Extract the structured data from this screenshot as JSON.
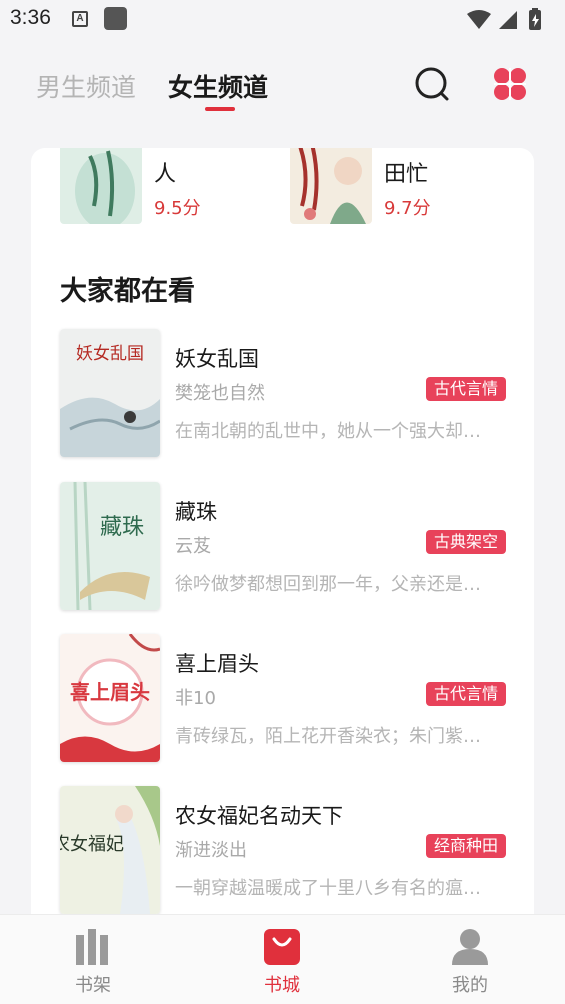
{
  "status_bar": {
    "time": "3:36",
    "notif_letter": "A"
  },
  "header": {
    "tabs": [
      {
        "label": "男生频道",
        "active": false
      },
      {
        "label": "女生频道",
        "active": true
      }
    ],
    "accent": "#e0303c"
  },
  "top_books": [
    {
      "name": "人",
      "score": "9.5分"
    },
    {
      "name": "田忙",
      "score": "9.7分"
    }
  ],
  "section": {
    "title": "大家都在看"
  },
  "books": [
    {
      "name": "妖女乱国",
      "author": "樊笼也自然",
      "tag": "古代言情",
      "desc": "在南北朝的乱世中，她从一个强大却…",
      "cover_text": "妖女乱国"
    },
    {
      "name": "藏珠",
      "author": "云芨",
      "tag": "古典架空",
      "desc": "徐吟做梦都想回到那一年，父亲还是…",
      "cover_text": "藏珠"
    },
    {
      "name": "喜上眉头",
      "author": "非10",
      "tag": "古代言情",
      "desc": "青砖绿瓦，陌上花开香染衣；朱门紫…",
      "cover_text": "喜上眉头"
    },
    {
      "name": "农女福妃名动天下",
      "author": "渐进淡出",
      "tag": "经商种田",
      "desc": "一朝穿越温暖成了十里八乡有名的瘟…",
      "cover_text": "农女福妃"
    }
  ],
  "bottom_nav": [
    {
      "label": "书架",
      "icon": "bookshelf-icon",
      "active": false
    },
    {
      "label": "书城",
      "icon": "shopping-bag-icon",
      "active": true
    },
    {
      "label": "我的",
      "icon": "user-icon",
      "active": false
    }
  ]
}
